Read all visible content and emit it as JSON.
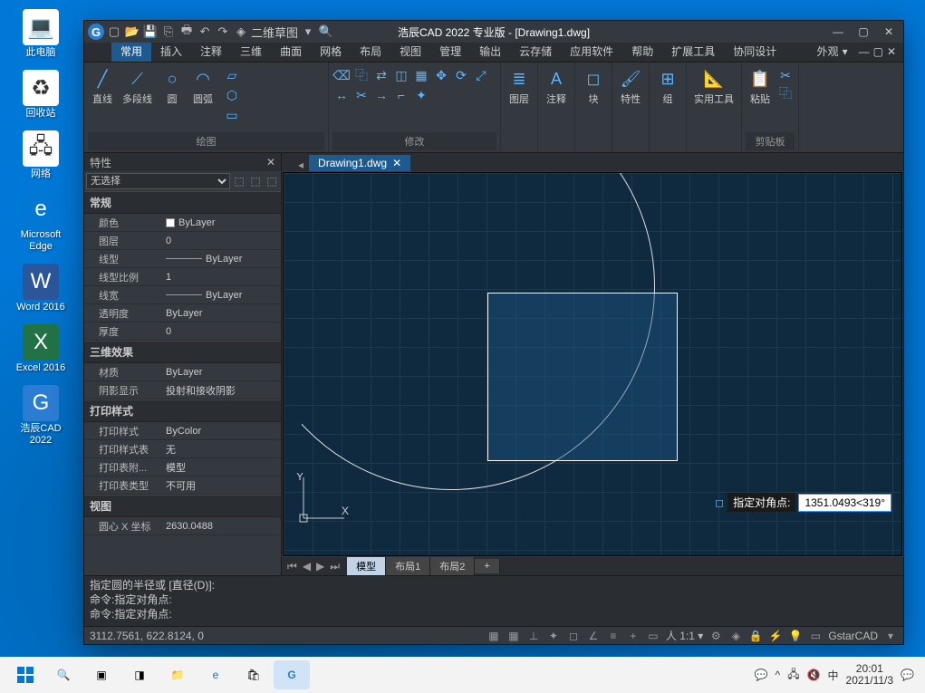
{
  "desktop": {
    "icons": [
      {
        "label": "此电脑",
        "glyph": "💻",
        "bg": "#fff"
      },
      {
        "label": "回收站",
        "glyph": "♻",
        "bg": "#fff"
      },
      {
        "label": "网络",
        "glyph": "🖧",
        "bg": "#fff"
      },
      {
        "label": "Microsoft\nEdge",
        "glyph": "e",
        "bg": "#0078d4"
      },
      {
        "label": "Word 2016",
        "glyph": "W",
        "bg": "#2b579a"
      },
      {
        "label": "Excel 2016",
        "glyph": "X",
        "bg": "#217346"
      },
      {
        "label": "浩辰CAD\n2022",
        "glyph": "G",
        "bg": "#2b7cd3"
      }
    ]
  },
  "taskbar": {
    "time": "20:01",
    "date": "2021/11/3",
    "ime": "中"
  },
  "app": {
    "title": "浩辰CAD 2022 专业版 - [Drawing1.dwg]",
    "workspace": "二维草图",
    "ribbon_tabs": [
      "常用",
      "插入",
      "注释",
      "三维",
      "曲面",
      "网格",
      "布局",
      "视图",
      "管理",
      "输出",
      "云存储",
      "应用软件",
      "帮助",
      "扩展工具",
      "协同设计"
    ],
    "active_tab": "常用",
    "appearance": "外观",
    "panels": {
      "draw": {
        "title": "绘图",
        "btns": [
          "直线",
          "多段线",
          "圆",
          "圆弧"
        ]
      },
      "modify": {
        "title": "修改"
      },
      "layer": {
        "title": "图层"
      },
      "annot": {
        "title": "注释"
      },
      "block": {
        "title": "块"
      },
      "props": {
        "title": "特性"
      },
      "group": {
        "title": "组"
      },
      "util": {
        "title": "实用工具"
      },
      "clip": {
        "title": "粘贴",
        "panel": "剪贴板"
      }
    },
    "props_panel": {
      "title": "特性",
      "selection": "无选择",
      "groups": [
        {
          "name": "常规",
          "rows": [
            {
              "k": "颜色",
              "v": "ByLayer",
              "swatch": true
            },
            {
              "k": "图层",
              "v": "0"
            },
            {
              "k": "线型",
              "v": "ByLayer",
              "line": true
            },
            {
              "k": "线型比例",
              "v": "1"
            },
            {
              "k": "线宽",
              "v": "ByLayer",
              "line": true
            },
            {
              "k": "透明度",
              "v": "ByLayer"
            },
            {
              "k": "厚度",
              "v": "0"
            }
          ]
        },
        {
          "name": "三维效果",
          "rows": [
            {
              "k": "材质",
              "v": "ByLayer"
            },
            {
              "k": "阴影显示",
              "v": "投射和接收阴影"
            }
          ]
        },
        {
          "name": "打印样式",
          "rows": [
            {
              "k": "打印样式",
              "v": "ByColor"
            },
            {
              "k": "打印样式表",
              "v": "无"
            },
            {
              "k": "打印表附...",
              "v": "模型"
            },
            {
              "k": "打印表类型",
              "v": "不可用"
            }
          ]
        },
        {
          "name": "视图",
          "rows": [
            {
              "k": "圆心 X 坐标",
              "v": "2630.0488"
            }
          ]
        }
      ]
    },
    "doc_tab": "Drawing1.dwg",
    "layout_tabs": [
      "模型",
      "布局1",
      "布局2"
    ],
    "active_layout": "模型",
    "cmd_tip": {
      "label": "指定对角点:",
      "value": "1351.0493<319°"
    },
    "cmdline": [
      "指定圆的半径或 [直径(D)]:",
      "命令:指定对角点:",
      "命令:指定对角点:"
    ],
    "status": {
      "coords": "3112.7561, 622.8124, 0",
      "scale": "1:1",
      "brand": "GstarCAD"
    }
  }
}
